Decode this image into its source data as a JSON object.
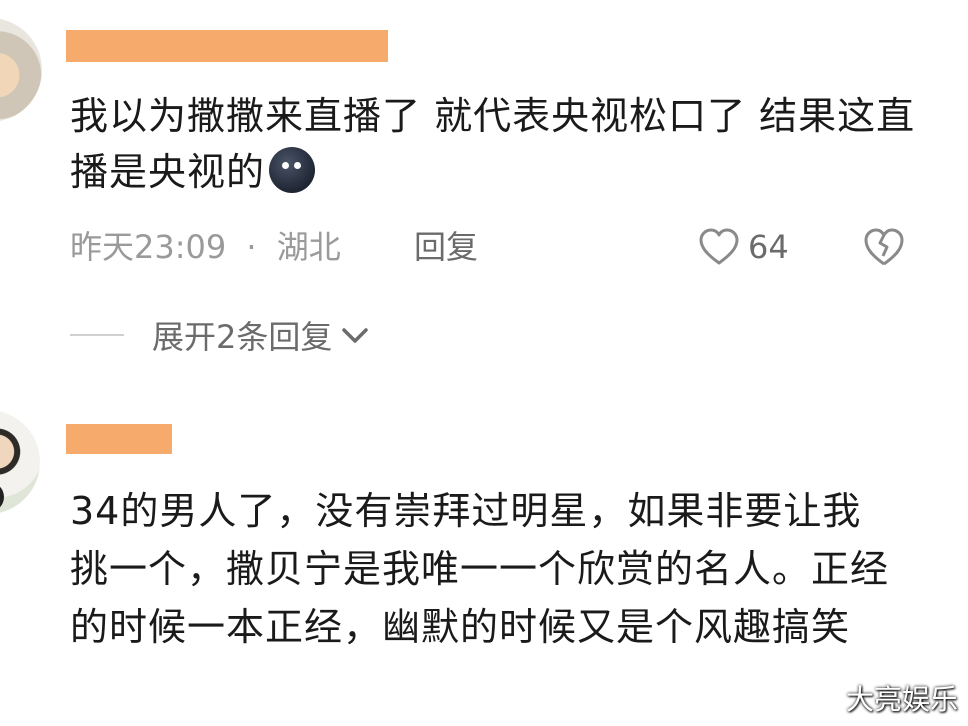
{
  "comments": [
    {
      "text": "我以为撒撒来直播了 就代表央视松口了 结果这直播是央视的",
      "emoji": "new-moon-face",
      "time": "昨天23:09",
      "sep": "·",
      "location": "湖北",
      "reply_label": "回复",
      "likes": "64",
      "expand_label": "展开2条回复"
    },
    {
      "text": "34的男人了，没有崇拜过明星，如果非要让我挑一个，撒贝宁是我唯一一个欣赏的名人。正经的时候一本正经，幽默的时候又是个风趣搞笑"
    }
  ],
  "watermark": "大亮娱乐",
  "colors": {
    "mask": "#f5a25d",
    "meta": "#9a9a9a",
    "text": "#1a1a1a"
  }
}
